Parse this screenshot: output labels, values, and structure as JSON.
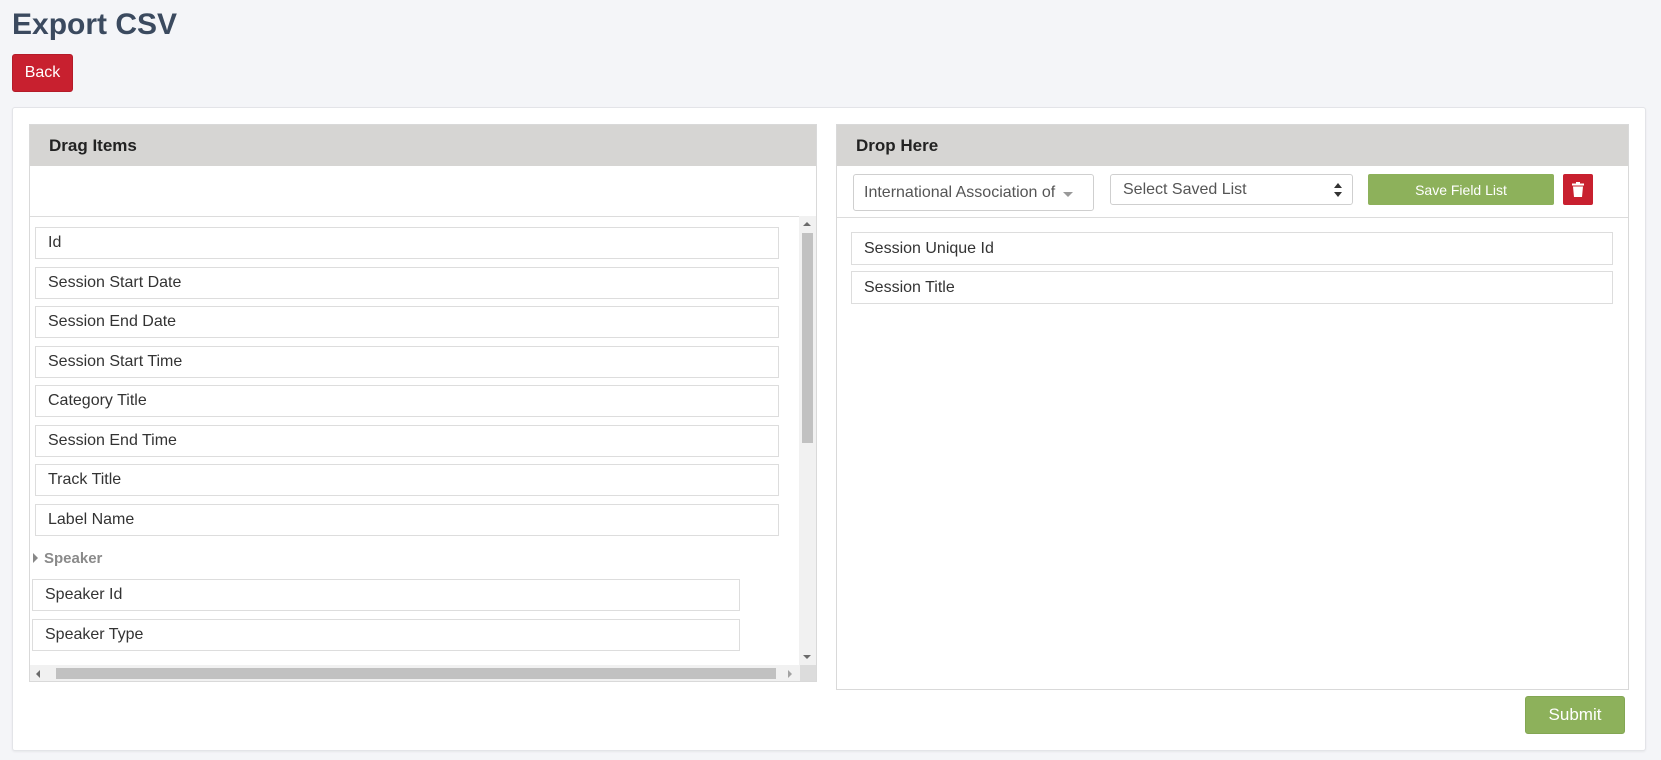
{
  "page": {
    "title": "Export CSV"
  },
  "actions": {
    "back_label": "Back",
    "submit_label": "Submit"
  },
  "left_panel": {
    "title": "Drag Items",
    "items": [
      "Id",
      "Session Start Date",
      "Session End Date",
      "Session Start Time",
      "Category Title",
      "Session End Time",
      "Track Title",
      "Label Name"
    ],
    "group": {
      "label": "Speaker",
      "items": [
        "Speaker Id",
        "Speaker Type"
      ]
    }
  },
  "right_panel": {
    "title": "Drop Here",
    "org_select_value": "International Association of",
    "saved_list_select_value": "Select Saved List",
    "save_button_label": "Save Field List",
    "items": [
      "Session Unique Id",
      "Session Title"
    ]
  },
  "colors": {
    "primary_red": "#c8202f",
    "primary_green": "#8db15b",
    "title_color": "#3b4a5f"
  },
  "icons": {
    "delete": "trash-icon",
    "group_toggle": "caret-right-icon"
  }
}
